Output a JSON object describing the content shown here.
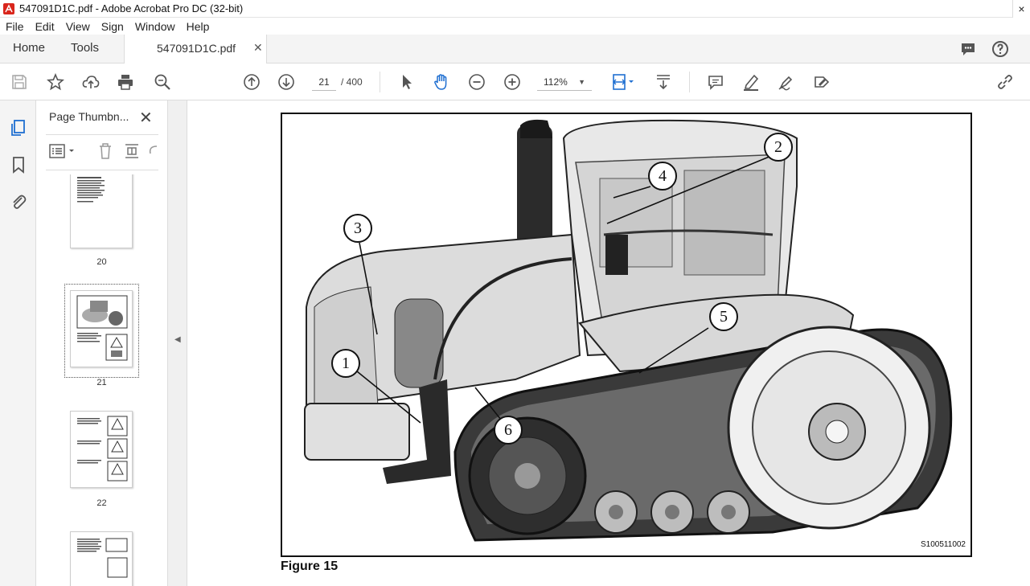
{
  "window": {
    "title": "547091D1C.pdf - Adobe Acrobat Pro DC (32-bit)"
  },
  "menu": [
    "File",
    "Edit",
    "View",
    "Sign",
    "Window",
    "Help"
  ],
  "tabs": {
    "home": "Home",
    "tools": "Tools",
    "document": "547091D1C.pdf"
  },
  "toolbar": {
    "page_current": "21",
    "page_total": "/ 400",
    "zoom": "112%"
  },
  "thumbnails": {
    "title": "Page Thumbn...",
    "pages": [
      {
        "label": "20"
      },
      {
        "label": "21",
        "selected": true
      },
      {
        "label": "22"
      }
    ]
  },
  "figure": {
    "code": "S100511002",
    "caption": "Figure 15",
    "callouts": [
      "1",
      "2",
      "3",
      "4",
      "5",
      "6"
    ]
  }
}
